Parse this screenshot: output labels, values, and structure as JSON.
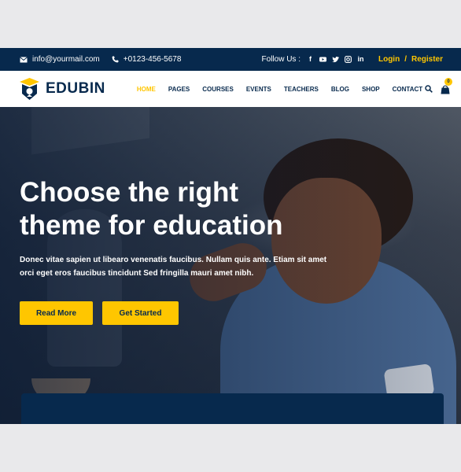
{
  "topbar": {
    "email": "info@yourmail.com",
    "phone": "+0123-456-5678",
    "follow_label": "Follow Us :",
    "social_icons": [
      "facebook-icon",
      "youtube-icon",
      "twitter-icon",
      "instagram-icon",
      "linkedin-icon"
    ],
    "login": "Login",
    "separator": "/",
    "register": "Register"
  },
  "nav": {
    "brand": "EDUBIN",
    "menu": [
      "HOME",
      "PAGES",
      "COURSES",
      "EVENTS",
      "TEACHERS",
      "BLOG",
      "SHOP",
      "CONTACT"
    ],
    "active_item": "HOME",
    "cart_count": "0"
  },
  "hero": {
    "title_line1": "Choose the right",
    "title_line2": "theme for education",
    "description": "Donec vitae sapien ut libearo venenatis faucibus. Nullam quis ante. Etiam sit amet orci eget eros faucibus tincidunt Sed fringilla mauri amet nibh.",
    "read_more": "Read More",
    "get_started": "Get Started"
  },
  "colors": {
    "navy": "#07294d",
    "accent": "#ffc600",
    "page_background": "#e9e9eb"
  }
}
